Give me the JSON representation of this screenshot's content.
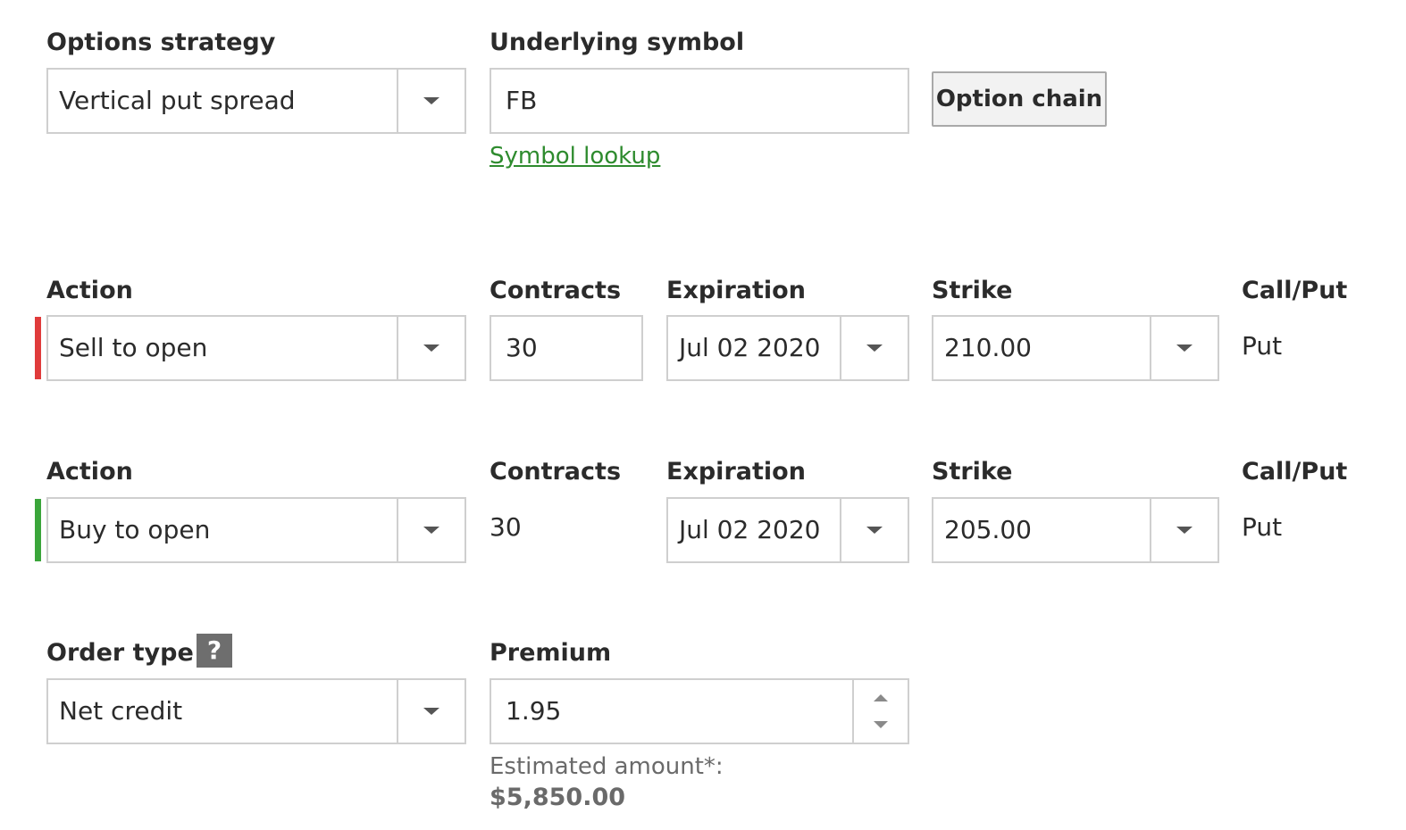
{
  "strategy": {
    "label": "Options strategy",
    "value": "Vertical put spread"
  },
  "underlying": {
    "label": "Underlying symbol",
    "value": "FB",
    "lookup_link": "Symbol lookup",
    "option_chain_button": "Option chain"
  },
  "legs": [
    {
      "action_label": "Action",
      "action": "Sell to open",
      "contracts_label": "Contracts",
      "contracts": "30",
      "expiration_label": "Expiration",
      "expiration": "Jul 02 2020",
      "strike_label": "Strike",
      "strike": "210.00",
      "callput_label": "Call/Put",
      "callput": "Put",
      "indicator_color": "#e03b3b"
    },
    {
      "action_label": "Action",
      "action": "Buy to open",
      "contracts_label": "Contracts",
      "contracts": "30",
      "expiration_label": "Expiration",
      "expiration": "Jul 02 2020",
      "strike_label": "Strike",
      "strike": "205.00",
      "callput_label": "Call/Put",
      "callput": "Put",
      "indicator_color": "#3aa53a"
    }
  ],
  "order": {
    "type_label": "Order type",
    "help_glyph": "?",
    "type": "Net credit",
    "premium_label": "Premium",
    "premium": "1.95",
    "estimated_label": "Estimated amount*:",
    "estimated_amount": "$5,850.00"
  },
  "colors": {
    "link": "#2e8b2e",
    "border": "#cfcfcf",
    "sell": "#e03b3b",
    "buy": "#3aa53a"
  }
}
